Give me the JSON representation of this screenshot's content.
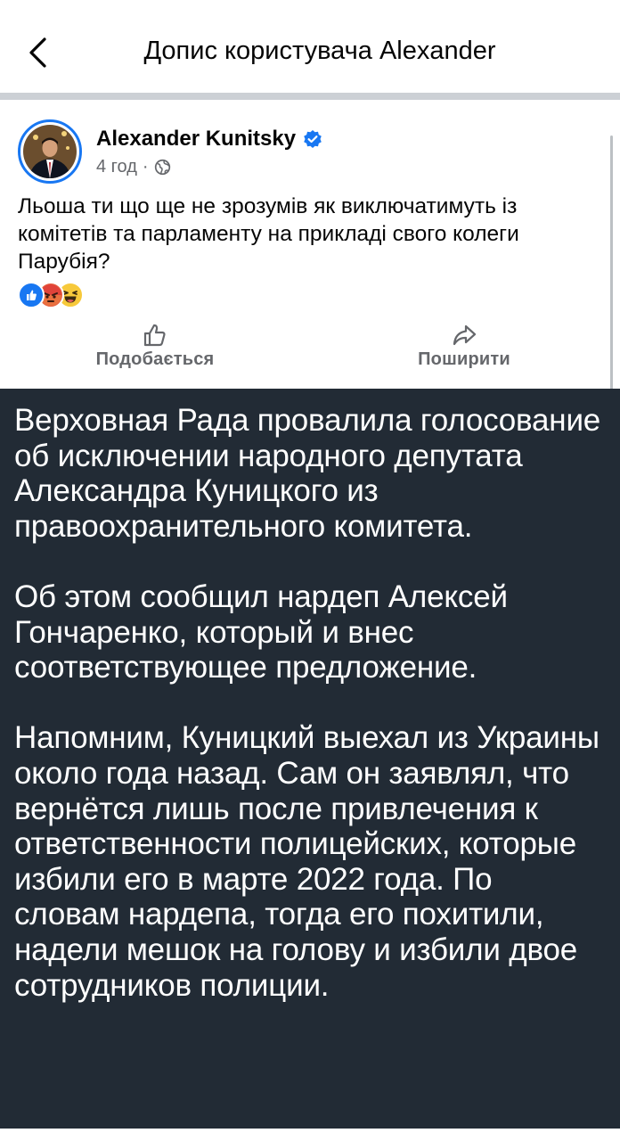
{
  "header": {
    "title": "Допис користувача Alexander",
    "back_icon": "chevron-left-icon"
  },
  "post": {
    "author": "Alexander Kunitsky",
    "time": "4 год",
    "separator": "·",
    "audience_icon": "globe-icon",
    "text": "Льоша ти що ще не зрозумів як виключатимуть із комітетів та парламенту на прикладі свого колеги Парубія?",
    "reactions": [
      "like",
      "angry",
      "haha"
    ]
  },
  "actions": {
    "like_label": "Подобається",
    "share_label": "Поширити"
  },
  "shared_card": {
    "paragraphs": [
      "Верховная Рада провалила голосование об исключении народного депутата Александра Куницкого из правоохранительного комитета.",
      "Об этом сообщил нардеп Алексей Гончаренко, который и внес соответствующее предложение.",
      "Напомним, Куницкий выехал из Украины около года назад. Сам он заявлял, что вернётся лишь после привлечения к ответственности полицейских, которые избили его в марте 2022 года. По словам нардепа, тогда его похитили, надели мешок на голову и избили двое сотрудников полиции."
    ]
  },
  "colors": {
    "accent": "#1877f2",
    "card_bg": "#222b35",
    "secondary_text": "#65676b"
  }
}
